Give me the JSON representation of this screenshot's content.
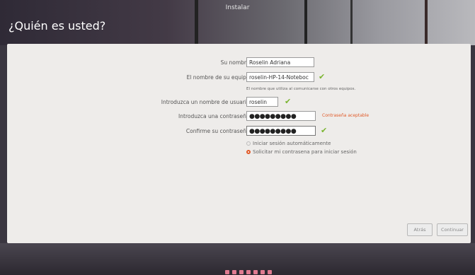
{
  "window": {
    "title": "Instalar"
  },
  "page": {
    "title": "¿Quién es usted?"
  },
  "form": {
    "name_label": "Su nombre:",
    "name_value": "Roselin Adriana",
    "computer_label": "El nombre de su equipo:",
    "computer_value": "roselin-HP-14-Noteboc",
    "computer_hint": "El nombre que utiliza al comunicarse con otros equipos.",
    "user_label": "Introduzca un nombre de usuario:",
    "user_value": "roselin",
    "password_label": "Introduzca una contraseña:",
    "password_value": "●●●●●●●●●",
    "password_strength": "Contraseña aceptable",
    "confirm_label": "Confirme su contraseña:",
    "confirm_value": "●●●●●●●●●",
    "option_auto": "Iniciar sesión automáticamente",
    "option_password": "Solicitar mi contrasena para iniciar sesión",
    "selected_option": "option_password"
  },
  "buttons": {
    "back": "Atrás",
    "continue": "Continuar"
  },
  "progress": {
    "total_steps": 7
  },
  "colors": {
    "accent": "#e05a28",
    "check": "#7bb531",
    "step_dot": "#e07b90"
  },
  "icons": {
    "valid": "check-icon"
  }
}
